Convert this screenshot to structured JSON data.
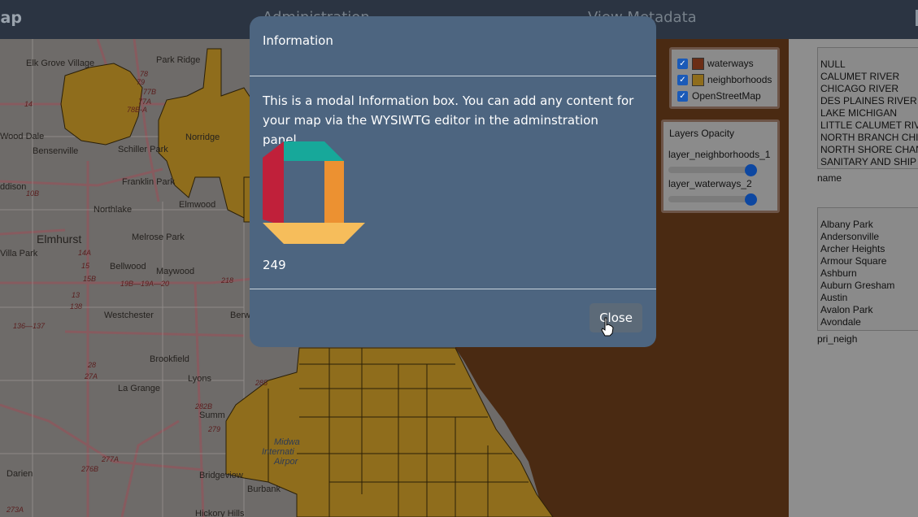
{
  "nav": {
    "brand": "lap",
    "administration": "Administration",
    "view_metadata": "View Metadata"
  },
  "map_labels": {
    "elk_grove_village": "Elk Grove Village",
    "park_ridge": "Park Ridge",
    "bensenville": "Bensenville",
    "schiller_park": "Schiller Park",
    "norridge": "Norridge",
    "franklin_park": "Franklin Park",
    "northlake": "Northlake",
    "elmwood": "Elmwood",
    "elmhurst": "Elmhurst",
    "melrose_park": "Melrose Park",
    "villa_park": "Villa Park",
    "bellwood": "Bellwood",
    "maywood": "Maywood",
    "westchester": "Westchester",
    "berwyn": "Berwyn",
    "brookfield": "Brookfield",
    "lyons": "Lyons",
    "la_grange": "La Grange",
    "summit": "Summ",
    "darien": "Darien",
    "bridgeview": "Bridgeview",
    "burbank": "Burbank",
    "hickory_hills": "Hickory Hills",
    "wood_dale": "Wood Dale",
    "addison": "ddison",
    "midway_airport": "Midwa",
    "midway_airport_2": "Internati",
    "midway_airport_3": "Airpor",
    "r_14": "14",
    "r_78": "78",
    "r_77b": "77B",
    "r_79": "79",
    "r_77a": "77A",
    "r_78ba": "78B-A",
    "r_10b": "10B",
    "r_14a": "14A",
    "r_15": "15",
    "r_15b": "15B",
    "r_19a": "19B—19A—20",
    "r_218": "218",
    "r_138": "138",
    "r_13": "13",
    "r_136": "136—137",
    "r_285": "285",
    "r_282b": "282B",
    "r_279": "279",
    "r_277a": "277A",
    "r_276b": "276B",
    "r_273a": "273A",
    "r_27a": "27A",
    "r_28": "28"
  },
  "modal": {
    "title": "Information",
    "body": "This is a modal Information box.  You can add any content for your map via the WYSIWTG editor in the adminstration panel.",
    "number": "249",
    "close_label": "Close",
    "logo_colors": [
      "#c0203a",
      "#17a89a",
      "#ec9131",
      "#f6bd5b"
    ]
  },
  "layers": {
    "items": [
      {
        "label": "waterways",
        "checked": true,
        "color": "#6b2d16"
      },
      {
        "label": "neighborhoods",
        "checked": true,
        "color": "#8f6d1c"
      },
      {
        "label": "OpenStreetMap",
        "checked": true
      }
    ]
  },
  "opacity": {
    "title": "Layers Opacity",
    "sliders": [
      {
        "label": "layer_neighborhoods_1",
        "value": 1.0
      },
      {
        "label": "layer_waterways_2",
        "value": 1.0
      }
    ]
  },
  "filters": {
    "name_options": [
      "NULL",
      "CALUMET RIVER",
      "CHICAGO RIVER",
      "DES PLAINES RIVER",
      "LAKE MICHIGAN",
      "LITTLE CALUMET RIV",
      "NORTH BRANCH CHI",
      "NORTH SHORE CHAN",
      "SANITARY AND SHIP"
    ],
    "name_caption": "name",
    "neigh_options": [
      "Albany Park",
      "Andersonville",
      "Archer Heights",
      "Armour Square",
      "Ashburn",
      "Auburn Gresham",
      "Austin",
      "Avalon Park",
      "Avondale"
    ],
    "neigh_caption": "pri_neigh"
  },
  "colors": {
    "neighborhood_fill": "#8f6d1c",
    "water": "#4a2a12",
    "modal_bg": "#4d6580"
  }
}
